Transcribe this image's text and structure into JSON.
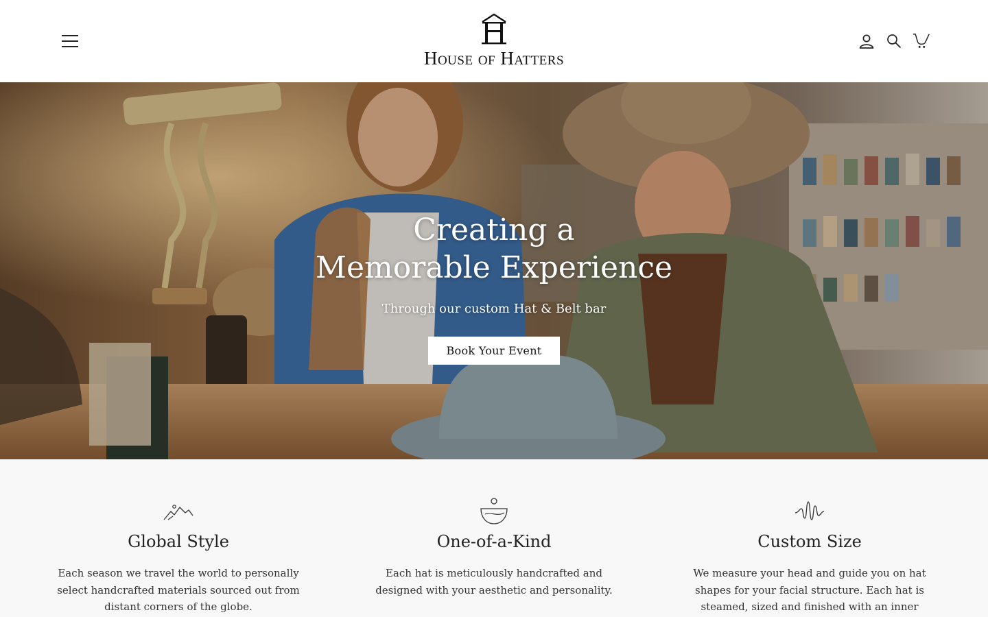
{
  "header": {
    "brand": "House of Hatters",
    "menu_icon": "hamburger-menu-icon",
    "icons": [
      "account-icon",
      "search-icon",
      "cart-icon"
    ]
  },
  "hero": {
    "title_line1": "Creating a",
    "title_line2": "Memorable Experience",
    "subtitle": "Through our custom Hat & Belt bar",
    "button_label": "Book Your Event"
  },
  "features": [
    {
      "icon": "mountains-icon",
      "title": "Global Style",
      "text": "Each season we travel the world to personally select handcrafted materials sourced out from distant corners of the globe."
    },
    {
      "icon": "bowl-icon",
      "title": "One-of-a-Kind",
      "text": "Each hat is meticulously handcrafted and designed with your aesthetic and personality."
    },
    {
      "icon": "waveform-icon",
      "title": "Custom Size",
      "text": "We measure your head and guide you on hat shapes for your facial structure. Each hat is steamed, sized and finished with an inner"
    }
  ],
  "colors": {
    "text": "#222222",
    "features_bg": "#f8f8f8",
    "button_bg": "#ffffff"
  }
}
